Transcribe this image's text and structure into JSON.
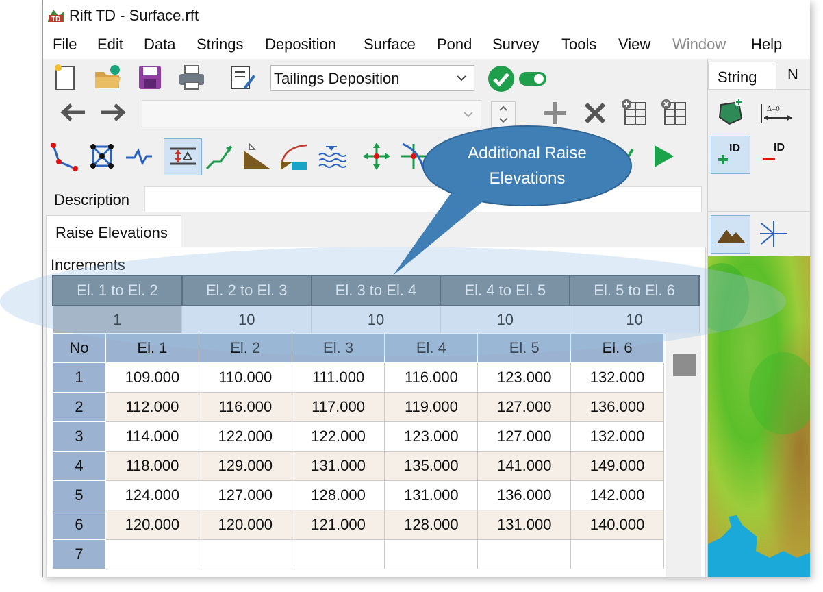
{
  "app": {
    "title": "Rift TD - Surface.rft",
    "logo_text": "TD"
  },
  "menu": [
    "File",
    "Edit",
    "Data",
    "Strings",
    "Deposition",
    "Surface",
    "Pond",
    "Survey",
    "Tools",
    "View",
    "Window",
    "Help"
  ],
  "toolbar": {
    "mode_select_value": "Tailings Deposition",
    "nav_combo_value": "",
    "icons": [
      "new-file-icon",
      "open-folder-icon",
      "save-icon",
      "print-icon",
      "edit-document-icon",
      "check-icon",
      "toggle-icon",
      "back-arrow-icon",
      "forward-arrow-icon",
      "add-icon",
      "delete-icon",
      "grid-add-icon",
      "grid-remove-icon",
      "polyline-icon",
      "mesh-icon",
      "profile-icon",
      "raise-elevation-icon",
      "slope-icon",
      "beach-icon",
      "curve-icon",
      "water-icon",
      "move-icon",
      "node-edit-icon",
      "run-icon"
    ]
  },
  "description": {
    "label": "Description",
    "value": ""
  },
  "tabs": {
    "active": "Raise Elevations"
  },
  "increments": {
    "label": "Increments",
    "headers": [
      "El. 1 to El. 2",
      "El. 2 to El. 3",
      "El. 3 to El. 4",
      "El. 4 to El. 5",
      "El. 5 to El. 6"
    ],
    "values": [
      "1",
      "10",
      "10",
      "10",
      "10"
    ]
  },
  "raise_table": {
    "headers": [
      "No",
      "El. 1",
      "El. 2",
      "El. 3",
      "El. 4",
      "El. 5",
      "El. 6"
    ],
    "rows": [
      [
        "1",
        "109.000",
        "110.000",
        "111.000",
        "116.000",
        "123.000",
        "132.000"
      ],
      [
        "2",
        "112.000",
        "116.000",
        "117.000",
        "119.000",
        "127.000",
        "136.000"
      ],
      [
        "3",
        "114.000",
        "122.000",
        "122.000",
        "123.000",
        "127.000",
        "132.000"
      ],
      [
        "4",
        "118.000",
        "129.000",
        "131.000",
        "135.000",
        "141.000",
        "149.000"
      ],
      [
        "5",
        "124.000",
        "127.000",
        "128.000",
        "131.000",
        "136.000",
        "142.000"
      ],
      [
        "6",
        "120.000",
        "120.000",
        "121.000",
        "128.000",
        "131.000",
        "140.000"
      ],
      [
        "7",
        "",
        "",
        "",
        "",
        "",
        ""
      ]
    ]
  },
  "right_panel": {
    "tab_string": "String",
    "tab_partial": "N",
    "delta_label": "Δ=0",
    "id_label": "ID"
  },
  "callout": {
    "text": "Additional Raise Elevations"
  },
  "colors": {
    "callout": "#3f7fb6",
    "header_dark": "#6c7b87",
    "header_blue": "#9bb3d0",
    "row_alt": "#f6efe8"
  }
}
